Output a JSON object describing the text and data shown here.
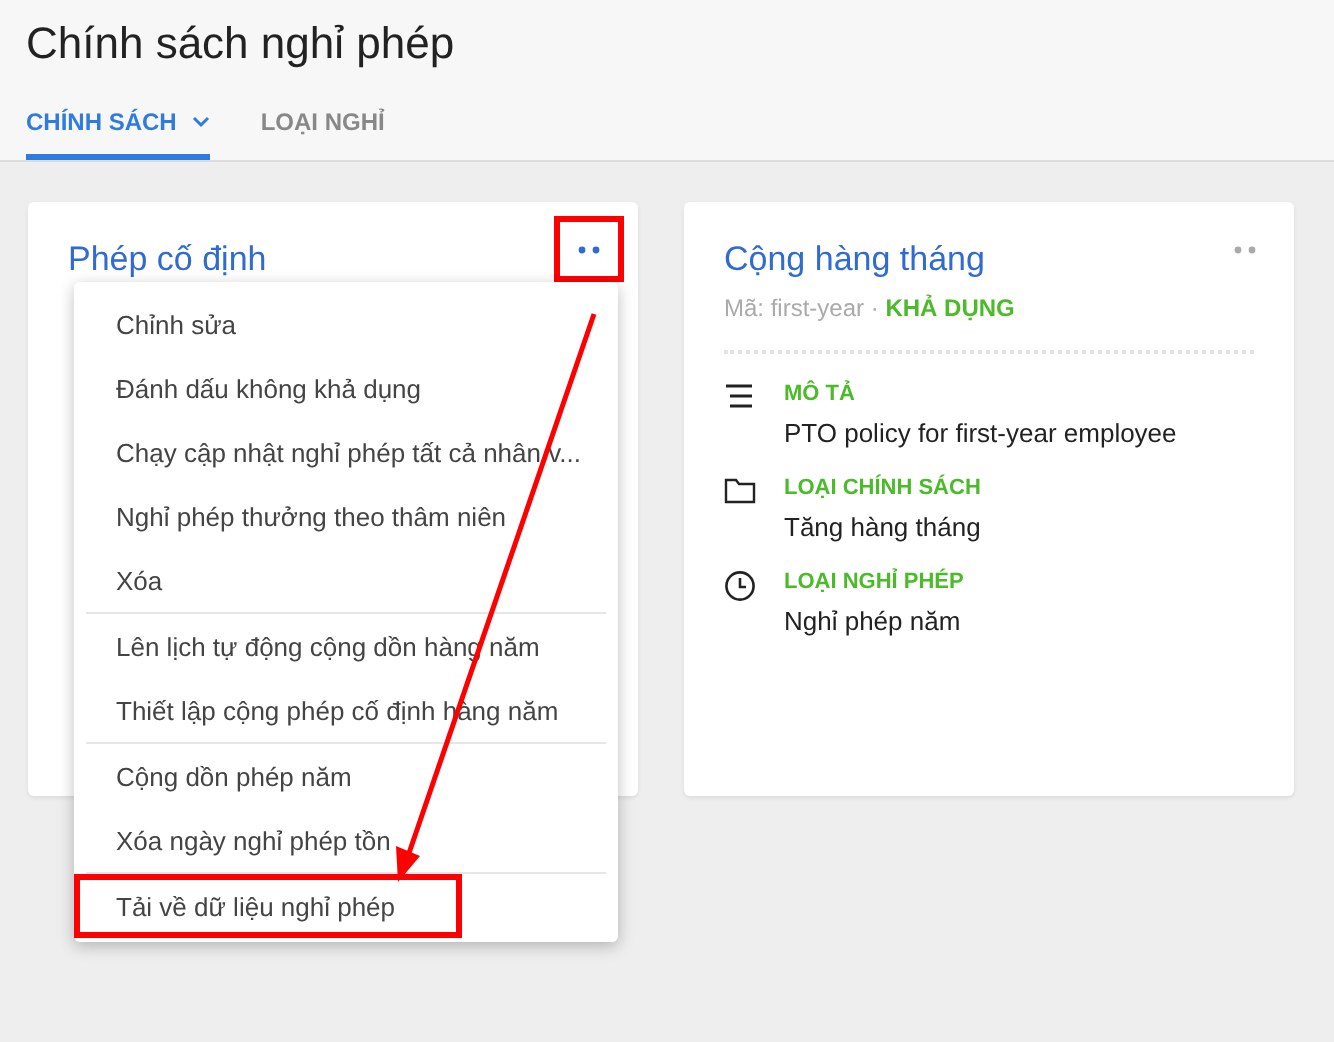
{
  "page": {
    "title": "Chính sách nghỉ phép"
  },
  "tabs": [
    {
      "label": "CHÍNH SÁCH",
      "selected": true,
      "dropdown": true
    },
    {
      "label": "LOẠI NGHỈ",
      "selected": false,
      "dropdown": false
    }
  ],
  "cards": [
    {
      "title": "Phép cố định",
      "annotated": true
    },
    {
      "title": "Cộng hàng tháng",
      "annotated": false,
      "code": "Mã: first-year",
      "separator": "·",
      "status": "KHẢ DỤNG",
      "fields": [
        {
          "kind": "description",
          "label": "MÔ TẢ",
          "value": "PTO policy for first-year employee"
        },
        {
          "kind": "folder",
          "label": "LOẠI CHÍNH SÁCH",
          "value": "Tăng hàng tháng"
        },
        {
          "kind": "clock",
          "label": "LOẠI NGHỈ PHÉP",
          "value": "Nghỉ phép năm"
        }
      ]
    }
  ],
  "menu": {
    "sections": [
      {
        "items": [
          {
            "label": "Chỉnh sửa",
            "annotated": false
          },
          {
            "label": "Đánh dấu không khả dụng",
            "annotated": false
          },
          {
            "label": "Chạy cập nhật nghỉ phép tất cả nhân v...",
            "annotated": false
          },
          {
            "label": "Nghỉ phép thưởng theo thâm niên",
            "annotated": false
          },
          {
            "label": "Xóa",
            "annotated": false
          }
        ]
      },
      {
        "items": [
          {
            "label": "Lên lịch tự động cộng dồn hàng năm",
            "annotated": false
          },
          {
            "label": "Thiết lập cộng phép cố định hàng năm",
            "annotated": false
          }
        ]
      },
      {
        "items": [
          {
            "label": "Cộng dồn phép năm",
            "annotated": false
          },
          {
            "label": "Xóa ngày nghỉ phép tồn",
            "annotated": false
          }
        ]
      },
      {
        "items": [
          {
            "label": "Tải về dữ liệu nghỉ phép",
            "annotated": true
          }
        ]
      }
    ]
  }
}
